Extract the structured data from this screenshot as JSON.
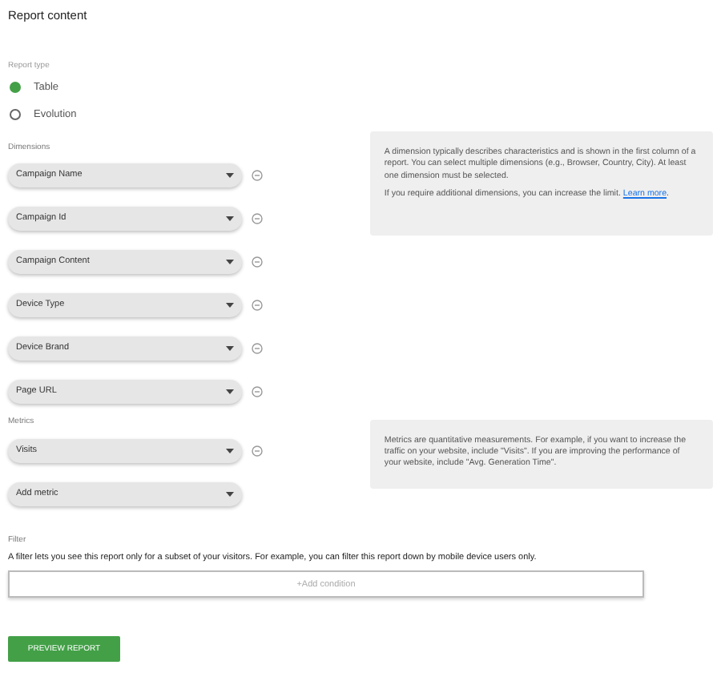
{
  "title": "Report content",
  "report_type": {
    "label": "Report type",
    "options": [
      {
        "label": "Table",
        "selected": true
      },
      {
        "label": "Evolution",
        "selected": false
      }
    ]
  },
  "dimensions": {
    "label": "Dimensions",
    "items": [
      "Campaign Name",
      "Campaign Id",
      "Campaign Content",
      "Device Type",
      "Device Brand",
      "Page URL"
    ],
    "help": "A dimension typically describes characteristics and is shown in the first column of a report. You can select multiple dimensions (e.g., Browser, Country, City). At least one dimension must be selected.",
    "help_2": "If you require additional dimensions, you can increase the limit.",
    "help_link": "Learn more",
    "help_end": "."
  },
  "metrics": {
    "label": "Metrics",
    "items": [
      "Visits"
    ],
    "add": "Add metric",
    "help": "Metrics are quantitative measurements. For example, if you want to increase the traffic on your website, include \"Visits\". If you are improving the performance of your website, include \"Avg. Generation Time\"."
  },
  "filter": {
    "label": "Filter",
    "description": "A filter lets you see this report only for a subset of your visitors. For example, you can filter this report down by mobile device users only.",
    "add": "+Add condition"
  },
  "preview_button": "PREVIEW REPORT"
}
